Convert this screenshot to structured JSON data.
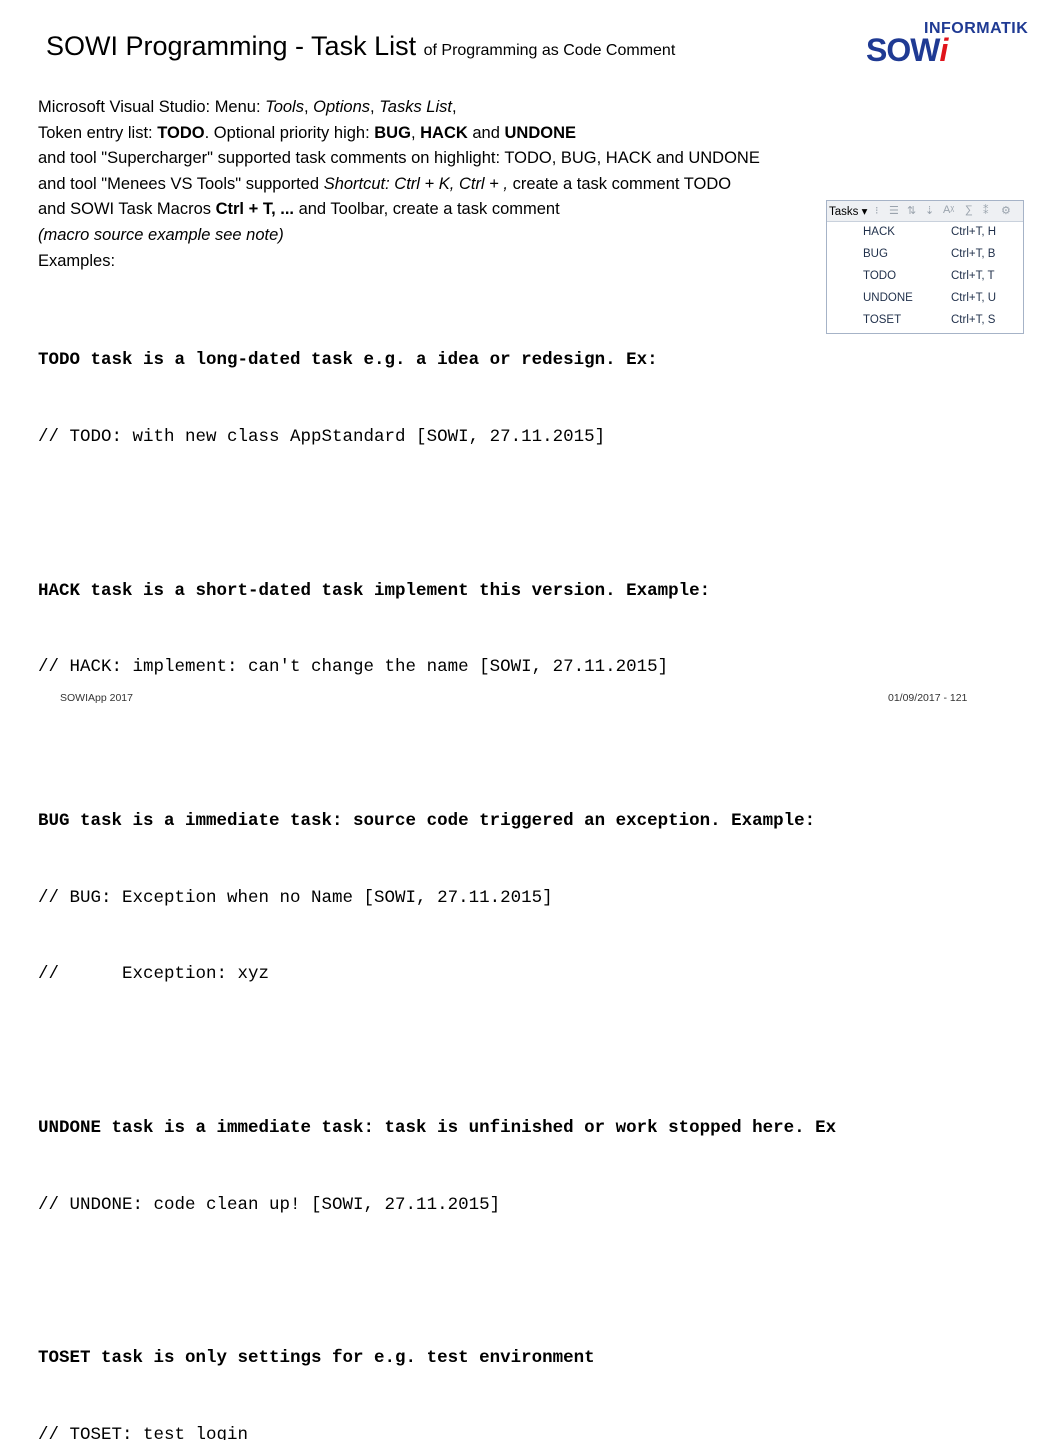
{
  "title": {
    "main": "SOWI Programming - Task List",
    "sub": "of Programming as Code Comment"
  },
  "logo": {
    "top": "INFORMATIK",
    "main_a": "SOW",
    "main_b": "i"
  },
  "intro": {
    "l1_a": "Microsoft Visual Studio: Menu: ",
    "l1_b": "Tools",
    "l1_c": ", ",
    "l1_d": "Options",
    "l1_e": ", ",
    "l1_f": "Tasks List",
    "l1_g": ",",
    "l2_a": "Token entry list: ",
    "l2_b": "TODO",
    "l2_c": ". Optional priority high: ",
    "l2_d": "BUG",
    "l2_e": ", ",
    "l2_f": "HACK",
    "l2_g": " and ",
    "l2_h": "UNDONE",
    "l3": "and tool \"Supercharger\" supported task comments on highlight: TODO, BUG, HACK and UNDONE",
    "l4_a": "and tool \"Menees VS Tools\" supported ",
    "l4_b": "Shortcut: Ctrl + K, Ctrl + ,",
    "l4_c": " create a task comment TODO",
    "l5_a": "and SOWI Task Macros ",
    "l5_b": "Ctrl + T, ...",
    "l5_c": " and Toolbar, create a task comment",
    "l6": "(macro source example see note)",
    "l7": "Examples:"
  },
  "code": [
    "TODO task is a long-dated task e.g. a idea or redesign. Ex:",
    "// TODO: with new class AppStandard [SOWI, 27.11.2015]",
    "",
    "HACK task is a short-dated task implement this version. Example:",
    "// HACK: implement: can't change the name [SOWI, 27.11.2015]",
    "",
    "BUG task is a immediate task: source code triggered an exception. Example:",
    "// BUG: Exception when no Name [SOWI, 27.11.2015]",
    "//      Exception: xyz",
    "",
    "UNDONE task is a immediate task: task is unfinished or work stopped here. Ex",
    "// UNDONE: code clean up! [SOWI, 27.11.2015]",
    "",
    "TOSET task is only settings for e.g. test environment",
    "// TOSET: test login"
  ],
  "task_menu": {
    "button": "Tasks",
    "items": [
      {
        "label": "HACK",
        "shortcut": "Ctrl+T, H"
      },
      {
        "label": "BUG",
        "shortcut": "Ctrl+T, B"
      },
      {
        "label": "TODO",
        "shortcut": "Ctrl+T, T"
      },
      {
        "label": "UNDONE",
        "shortcut": "Ctrl+T, U"
      },
      {
        "label": "TOSET",
        "shortcut": "Ctrl+T, S"
      }
    ]
  },
  "footer": {
    "left": "SOWIApp 2017",
    "right": "01/09/2017 - 121"
  }
}
